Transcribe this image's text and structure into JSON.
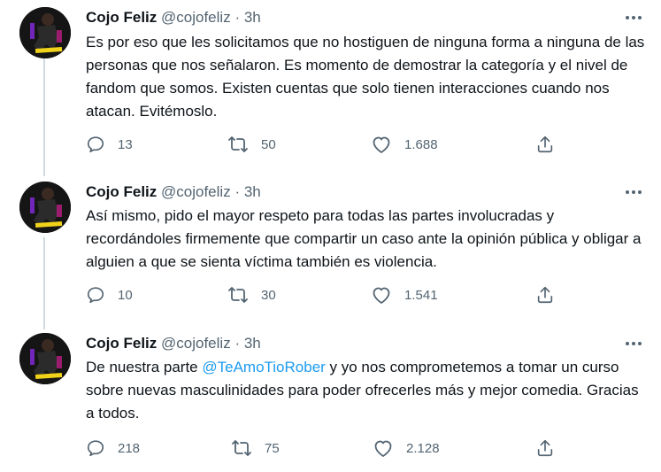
{
  "tweets": [
    {
      "author": {
        "name": "Cojo Feliz",
        "handle": "@cojofeliz",
        "time": "3h"
      },
      "separator": "·",
      "text_parts": [
        "Es por eso que les solicitamos que no hostiguen de ninguna forma a ninguna de las personas que nos señalaron. Es momento de demostrar la categoría y el nivel de fandom que somos. Existen cuentas que solo tienen interacciones cuando nos atacan. Evitémoslo."
      ],
      "replies": "13",
      "retweets": "50",
      "likes": "1.688"
    },
    {
      "author": {
        "name": "Cojo Feliz",
        "handle": "@cojofeliz",
        "time": "3h"
      },
      "separator": "·",
      "text_parts": [
        "Así mismo, pido el mayor respeto para todas las partes involucradas y recordándoles firmemente que compartir un caso ante la opinión pública y obligar a alguien a que se sienta víctima también es violencia."
      ],
      "replies": "10",
      "retweets": "30",
      "likes": "1.541"
    },
    {
      "author": {
        "name": "Cojo Feliz",
        "handle": "@cojofeliz",
        "time": "3h"
      },
      "separator": "·",
      "text_before": "De nuestra parte ",
      "mention": "@TeAmoTioRober",
      "text_after": " y yo nos comprometemos a tomar un curso sobre nuevas masculinidades para poder ofrecerles más y mejor comedia. Gracias a todos.",
      "replies": "218",
      "retweets": "75",
      "likes": "2.128"
    }
  ],
  "avatar_badge_text": "EL COJO FELIZ",
  "icons": {
    "reply": "reply-icon",
    "retweet": "retweet-icon",
    "like": "heart-icon",
    "share": "share-icon",
    "more": "more-icon"
  },
  "colors": {
    "mention": "#1d9bf0",
    "muted": "#536471",
    "text": "#0f1419",
    "avatar_accent": "#f0d21a"
  }
}
